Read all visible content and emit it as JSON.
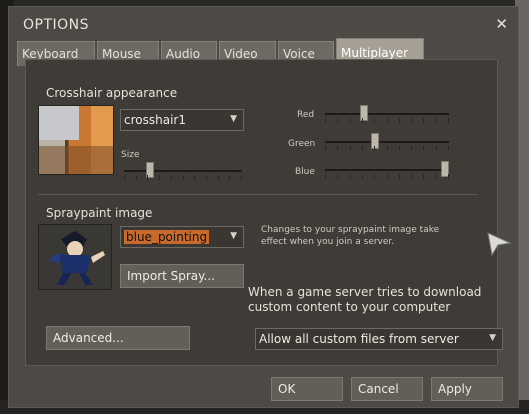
{
  "window": {
    "title": "OPTIONS",
    "close_glyph": "✕"
  },
  "tabs": [
    {
      "label": "Keyboard"
    },
    {
      "label": "Mouse"
    },
    {
      "label": "Audio"
    },
    {
      "label": "Video"
    },
    {
      "label": "Voice"
    },
    {
      "label": "Multiplayer",
      "active": true
    }
  ],
  "crosshair": {
    "section_label": "Crosshair appearance",
    "selected": "crosshair1",
    "size_label": "Size",
    "size_value": 0.2,
    "red_label": "Red",
    "red_value": 0.3,
    "green_label": "Green",
    "green_value": 0.4,
    "blue_label": "Blue",
    "blue_value": 1.0
  },
  "spray": {
    "section_label": "Spraypaint image",
    "selected": "blue_pointing",
    "note": "Changes to your spraypaint image take effect when you join a server.",
    "import_button": "Import Spray..."
  },
  "download": {
    "text": "When a game server tries to download custom content to your computer",
    "selected": "Allow all custom files from server"
  },
  "buttons": {
    "advanced": "Advanced...",
    "ok": "OK",
    "cancel": "Cancel",
    "apply": "Apply"
  },
  "colors": {
    "accent": "#c86a2b",
    "dialog_bg": "#4d4a45",
    "panel_bg": "#3f3c38"
  }
}
